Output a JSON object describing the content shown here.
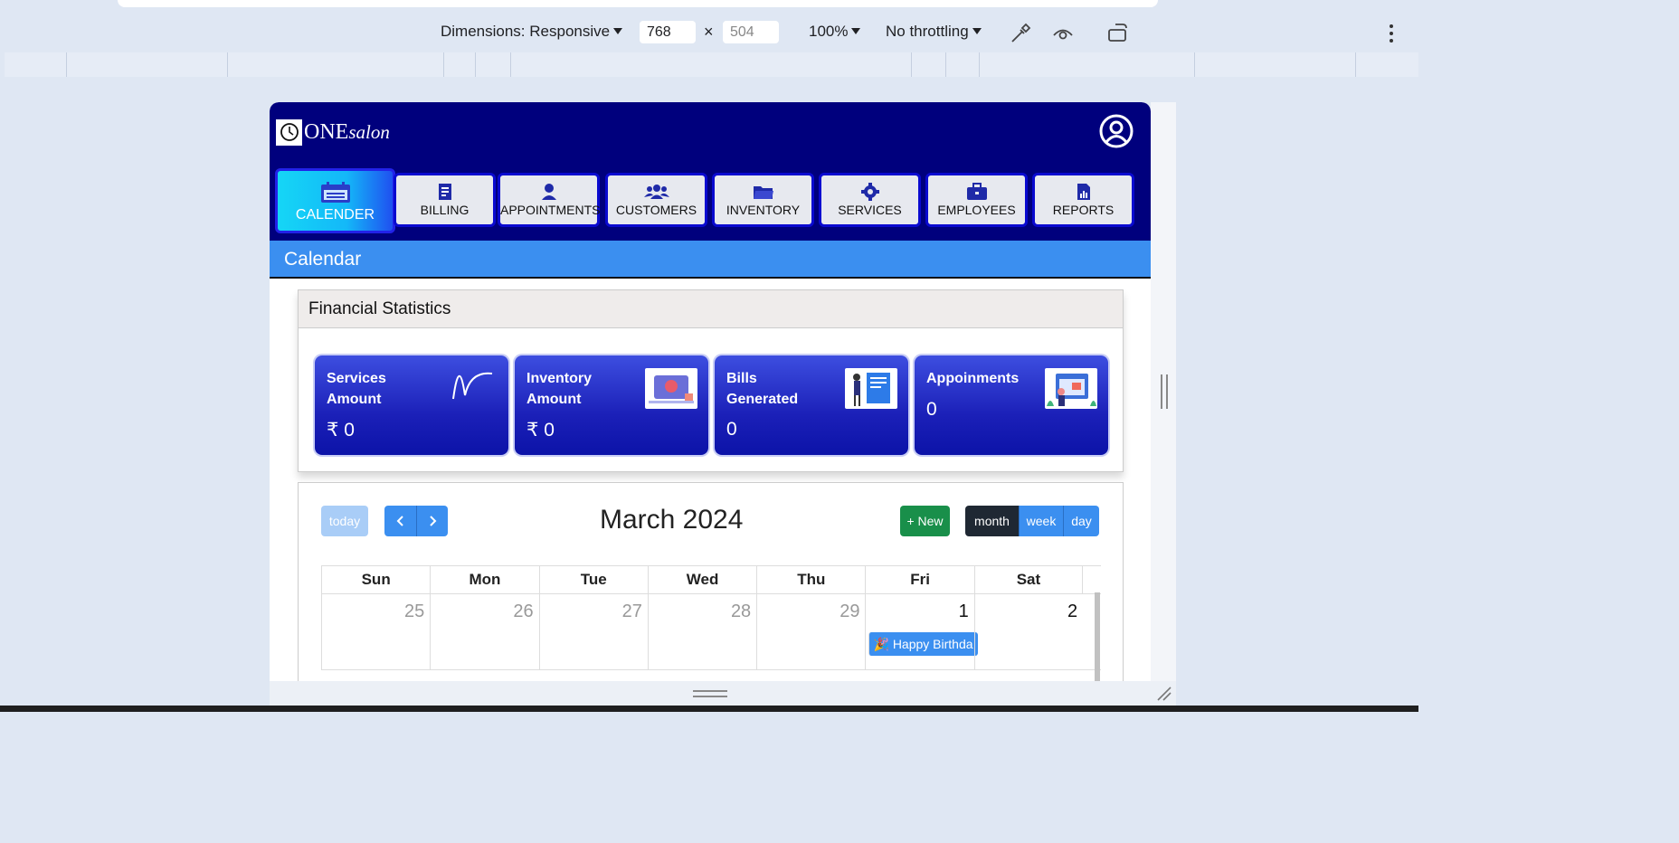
{
  "devtools": {
    "dimensions_label": "Dimensions: Responsive",
    "width_value": "768",
    "height_value": "504",
    "zoom": "100%",
    "throttling": "No throttling"
  },
  "app": {
    "logo_text": "ONE",
    "logo_italic": "salon",
    "nav": [
      {
        "label": "CALENDER",
        "icon": "calendar-icon"
      },
      {
        "label": "BILLING",
        "icon": "receipt-icon"
      },
      {
        "label": "APPOINTMENTS",
        "icon": "person-icon"
      },
      {
        "label": "CUSTOMERS",
        "icon": "users-icon"
      },
      {
        "label": "INVENTORY",
        "icon": "folder-icon"
      },
      {
        "label": "SERVICES",
        "icon": "gear-icon"
      },
      {
        "label": "EMPLOYEES",
        "icon": "briefcase-icon"
      },
      {
        "label": "REPORTS",
        "icon": "report-icon"
      }
    ],
    "page_title": "Calendar"
  },
  "financial": {
    "heading": "Financial Statistics",
    "cards": [
      {
        "label": "Services Amount",
        "value": "₹ 0"
      },
      {
        "label": "Inventory Amount",
        "value": "₹ 0"
      },
      {
        "label": "Bills Generated",
        "value": "0"
      },
      {
        "label": "Appoinments",
        "value": "0"
      }
    ]
  },
  "calendar": {
    "today_label": "today",
    "title": "March 2024",
    "new_label": "+ New",
    "views": [
      "month",
      "week",
      "day"
    ],
    "active_view": "month",
    "weekdays": [
      "Sun",
      "Mon",
      "Tue",
      "Wed",
      "Thu",
      "Fri",
      "Sat"
    ],
    "first_week": [
      "25",
      "26",
      "27",
      "28",
      "29",
      "1",
      "2"
    ],
    "event_label": "Happy Birthda",
    "colors": {
      "primary": "#3b8ff0",
      "success": "#198f4a",
      "dark": "#1f2833",
      "header": "#00007d"
    }
  }
}
